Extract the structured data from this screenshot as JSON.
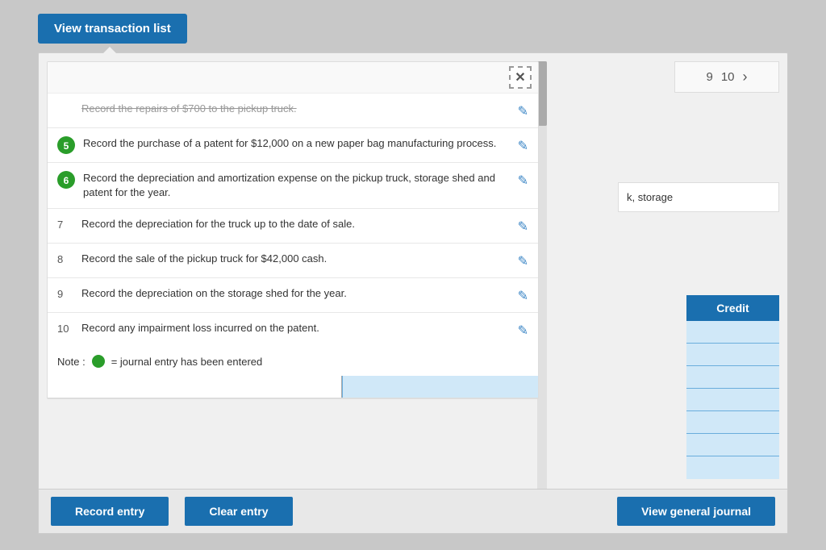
{
  "header": {
    "view_transaction_btn": "View transaction list"
  },
  "close_btn": "✕",
  "transactions": [
    {
      "id": "faded",
      "num": "",
      "badge": false,
      "text": "Record the repairs of $700 to the pickup truck.",
      "faded": true
    },
    {
      "id": "5",
      "num": "5",
      "badge": true,
      "text": "Record the purchase of a patent for $12,000 on a new paper bag manufacturing process.",
      "faded": false
    },
    {
      "id": "6",
      "num": "6",
      "badge": true,
      "text": "Record the depreciation and amortization expense on the pickup truck, storage shed and patent for the year.",
      "faded": false
    },
    {
      "id": "7",
      "num": "7",
      "badge": false,
      "text": "Record the depreciation for the truck up to the date of sale.",
      "faded": false
    },
    {
      "id": "8",
      "num": "8",
      "badge": false,
      "text": "Record the sale of the pickup truck for $42,000 cash.",
      "faded": false
    },
    {
      "id": "9",
      "num": "9",
      "badge": false,
      "text": "Record the depreciation on the storage shed for the year.",
      "faded": false
    },
    {
      "id": "10",
      "num": "10",
      "badge": false,
      "text": "Record any impairment loss incurred on the patent.",
      "faded": false
    }
  ],
  "note": {
    "label": "Note :",
    "description": "= journal entry has been entered"
  },
  "pagination": {
    "page9": "9",
    "page10": "10",
    "chevron": "›"
  },
  "journal_info": "k, storage",
  "credit_header": "Credit",
  "credit_rows_count": 7,
  "bottom_buttons": {
    "record_entry": "Record entry",
    "clear_entry": "Clear entry",
    "view_general_journal": "View general journal"
  }
}
